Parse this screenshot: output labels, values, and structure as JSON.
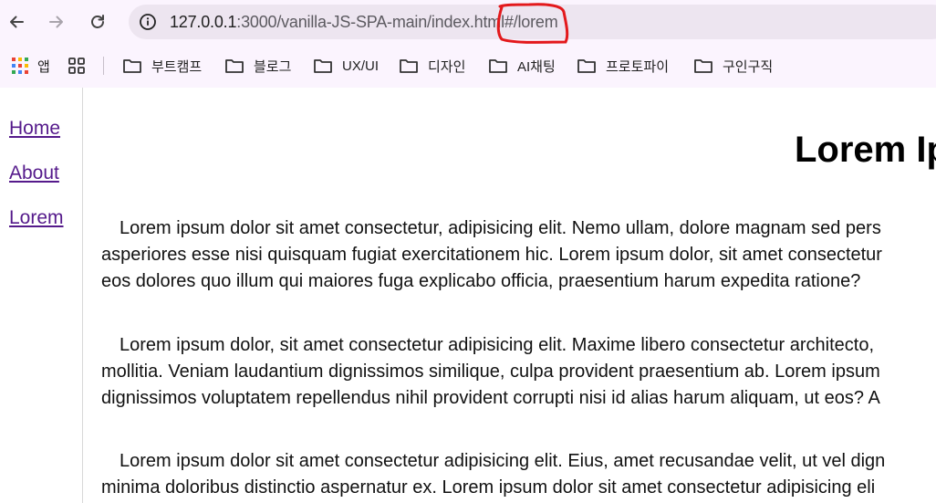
{
  "browser": {
    "url_host": "127.0.0.1",
    "url_path": ":3000/vanilla-JS-SPA-main/index.html#/lorem",
    "annotation_color": "#e3191c",
    "bookmarks": [
      {
        "label": "앱",
        "icon": "apps-grid-icon"
      },
      {
        "label": "",
        "icon": "tab-groups-icon"
      },
      {
        "label": "부트캠프",
        "icon": "folder-icon"
      },
      {
        "label": "블로그",
        "icon": "folder-icon"
      },
      {
        "label": "UX/UI",
        "icon": "folder-icon"
      },
      {
        "label": "디자인",
        "icon": "folder-icon"
      },
      {
        "label": "AI채팅",
        "icon": "folder-icon"
      },
      {
        "label": "프로토파이",
        "icon": "folder-icon"
      },
      {
        "label": "구인구직",
        "icon": "folder-icon"
      }
    ]
  },
  "sidebar": {
    "links": [
      {
        "label": "Home"
      },
      {
        "label": "About"
      },
      {
        "label": "Lorem"
      }
    ]
  },
  "main": {
    "heading": "Lorem Ipsum",
    "paragraphs": [
      {
        "lines": [
          "Lorem ipsum dolor sit amet consectetur, adipisicing elit. Nemo ullam, dolore magnam sed pers",
          "asperiores esse nisi quisquam fugiat exercitationem hic. Lorem ipsum dolor, sit amet consectetur",
          "eos dolores quo illum qui maiores fuga explicabo officia, praesentium harum expedita ratione?"
        ]
      },
      {
        "lines": [
          "Lorem ipsum dolor, sit amet consectetur adipisicing elit. Maxime libero consectetur architecto,",
          "mollitia. Veniam laudantium dignissimos similique, culpa provident praesentium ab. Lorem ipsum",
          "dignissimos voluptatem repellendus nihil provident corrupti nisi id alias harum aliquam, ut eos? A"
        ]
      },
      {
        "lines": [
          "Lorem ipsum dolor sit amet consectetur adipisicing elit. Eius, amet recusandae velit, ut vel dign",
          "minima doloribus distinctio aspernatur ex. Lorem ipsum dolor sit amet consectetur adipisicing eli"
        ]
      }
    ]
  }
}
